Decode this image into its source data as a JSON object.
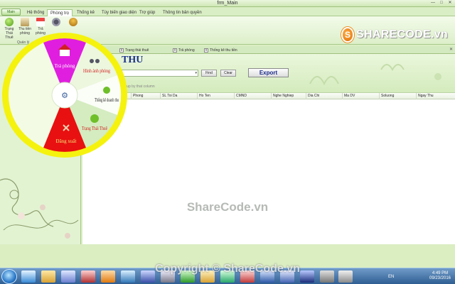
{
  "window": {
    "title": "frm_Main",
    "controls": [
      "—",
      "□",
      "✕"
    ]
  },
  "ribbon": {
    "app_button": "Main",
    "tabs": [
      "Hệ thống",
      "Phòng trọ",
      "Thống kê",
      "Tùy biến giao diện",
      "Trợ giúp",
      "Thông tin bản quyền"
    ],
    "active_tab": "Phòng trọ",
    "buttons": [
      {
        "label": "Trạng Thái Thuê",
        "icon": "check-icon"
      },
      {
        "label": "Thu tiền phòng",
        "icon": "money-icon"
      },
      {
        "label": "Trả phòng",
        "icon": "house-icon"
      },
      {
        "label": "",
        "icon": "binoculars-icon"
      },
      {
        "label": "",
        "icon": "users-icon"
      }
    ],
    "group_label": "Quản lý"
  },
  "brand": {
    "name": "SHARECODE",
    "suffix": ".vn"
  },
  "doc_tabs": [
    "Trạng thái thuê",
    "Trả phòng",
    "Thống kê thu tiền"
  ],
  "main": {
    "heading": "THU",
    "search_value": "",
    "find_label": "Find",
    "clear_label": "Clear",
    "export_label": "Export",
    "group_hint": "group by that column"
  },
  "grid": {
    "columns": [
      "Phong",
      "SL Toi Da",
      "Ho Ten",
      "CMND",
      "Nghe Nghiep",
      "Dia Chi",
      "Ma DV",
      "Soluong",
      "Ngay Thu"
    ]
  },
  "radial_menu": {
    "items": [
      "Trả phòng",
      "Hình ảnh phòng",
      "Thống kê doanh thu",
      "Trạng Thái Thuê",
      "Đăng xuất"
    ],
    "center": "⚙",
    "colors": {
      "rim": "#f5f20e",
      "pink": "#e01ee0",
      "red": "#e81010",
      "pale": "#f4fbe4",
      "green": "#d4ecc0"
    }
  },
  "watermark": {
    "center": "ShareCode.vn",
    "bottom": "Copyright © ShareCode.vn"
  },
  "taskbar": {
    "lang": "EN",
    "time": "4:49 PM",
    "date": "09/23/2016"
  }
}
